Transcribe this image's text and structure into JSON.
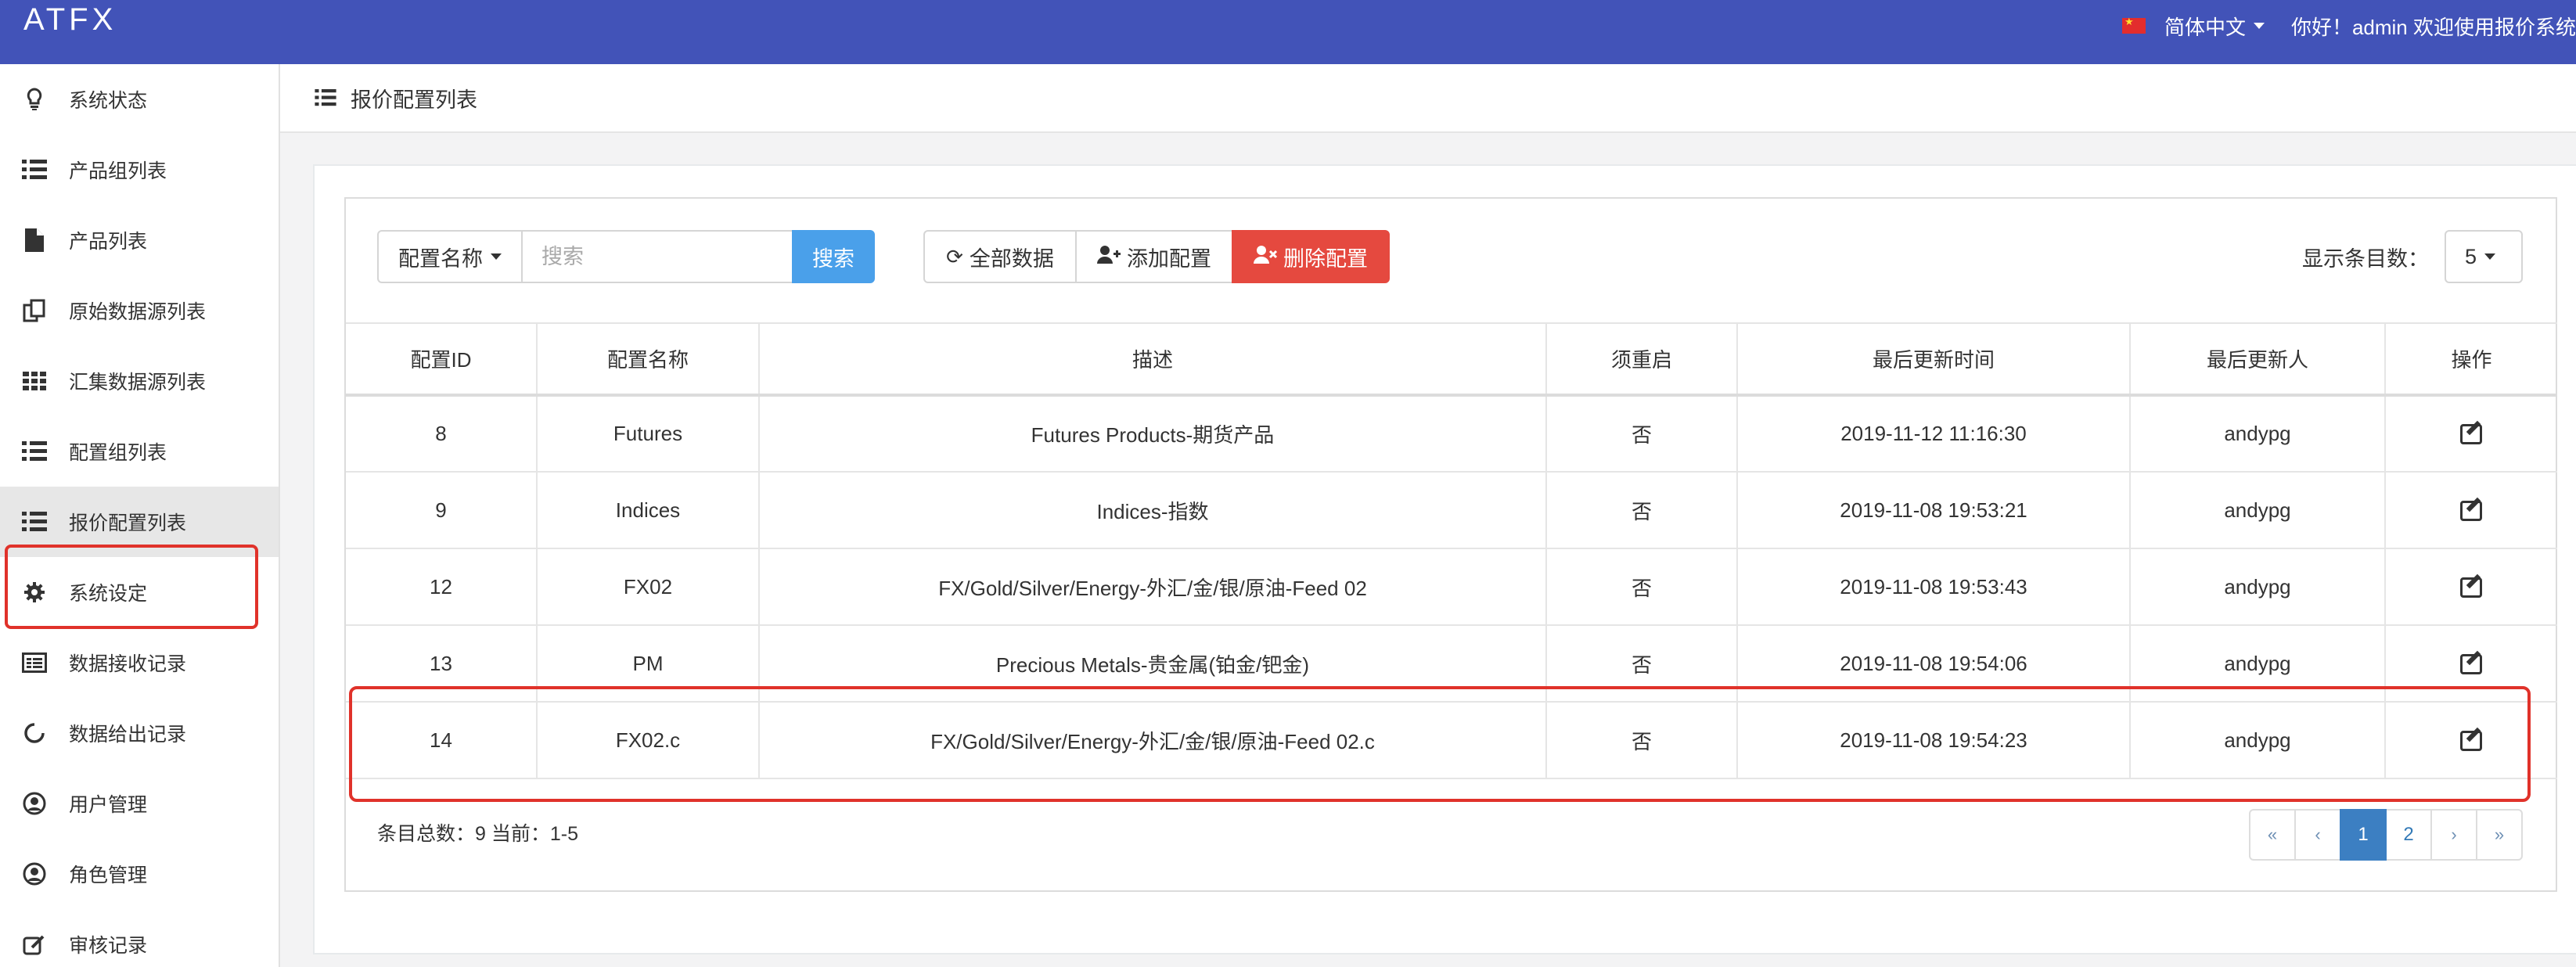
{
  "header": {
    "logo": "ATFX",
    "language": "简体中文",
    "greeting": "你好！admin  欢迎使用报价系统"
  },
  "sidebar": {
    "items": [
      {
        "label": "系统状态",
        "icon": "lightbulb-icon"
      },
      {
        "label": "产品组列表",
        "icon": "list-icon"
      },
      {
        "label": "产品列表",
        "icon": "file-icon"
      },
      {
        "label": "原始数据源列表",
        "icon": "copy-icon"
      },
      {
        "label": "汇集数据源列表",
        "icon": "grid-icon"
      },
      {
        "label": "配置组列表",
        "icon": "list-icon"
      },
      {
        "label": "报价配置列表",
        "icon": "list-icon",
        "active": true
      },
      {
        "label": "系统设定",
        "icon": "gear-icon"
      },
      {
        "label": "数据接收记录",
        "icon": "card-icon"
      },
      {
        "label": "数据给出记录",
        "icon": "spinner-icon"
      },
      {
        "label": "用户管理",
        "icon": "user-circle-icon"
      },
      {
        "label": "角色管理",
        "icon": "user-circle-icon"
      },
      {
        "label": "审核记录",
        "icon": "edit-icon"
      }
    ]
  },
  "page": {
    "title": "报价配置列表"
  },
  "toolbar": {
    "filter_field": "配置名称",
    "search_placeholder": "搜索",
    "search_button": "搜索",
    "all_data": "全部数据",
    "add_config": "添加配置",
    "delete_config": "删除配置",
    "page_size_label": "显示条目数：",
    "page_size": "5"
  },
  "table": {
    "columns": [
      "配置ID",
      "配置名称",
      "描述",
      "须重启",
      "最后更新时间",
      "最后更新人",
      "操作"
    ],
    "rows": [
      {
        "id": "8",
        "name": "Futures",
        "desc": "Futures Products-期货产品",
        "restart": "否",
        "updated": "2019-11-12 11:16:30",
        "user": "andypg"
      },
      {
        "id": "9",
        "name": "Indices",
        "desc": "Indices-指数",
        "restart": "否",
        "updated": "2019-11-08 19:53:21",
        "user": "andypg"
      },
      {
        "id": "12",
        "name": "FX02",
        "desc": "FX/Gold/Silver/Energy-外汇/金/银/原油-Feed 02",
        "restart": "否",
        "updated": "2019-11-08 19:53:43",
        "user": "andypg"
      },
      {
        "id": "13",
        "name": "PM",
        "desc": "Precious Metals-贵金属(铂金/钯金)",
        "restart": "否",
        "updated": "2019-11-08 19:54:06",
        "user": "andypg"
      },
      {
        "id": "14",
        "name": "FX02.c",
        "desc": "FX/Gold/Silver/Energy-外汇/金/银/原油-Feed 02.c",
        "restart": "否",
        "updated": "2019-11-08 19:54:23",
        "user": "andypg"
      }
    ]
  },
  "footer": {
    "summary": "条目总数：9 当前：1-5",
    "pages": [
      "«",
      "‹",
      "1",
      "2",
      "›",
      "»"
    ],
    "current_page": "1"
  },
  "colors": {
    "topbar": "#4253b8",
    "primary": "#4aa0ea",
    "danger": "#e5493f",
    "highlight": "#e0322a",
    "active_page": "#3c7fc2"
  }
}
